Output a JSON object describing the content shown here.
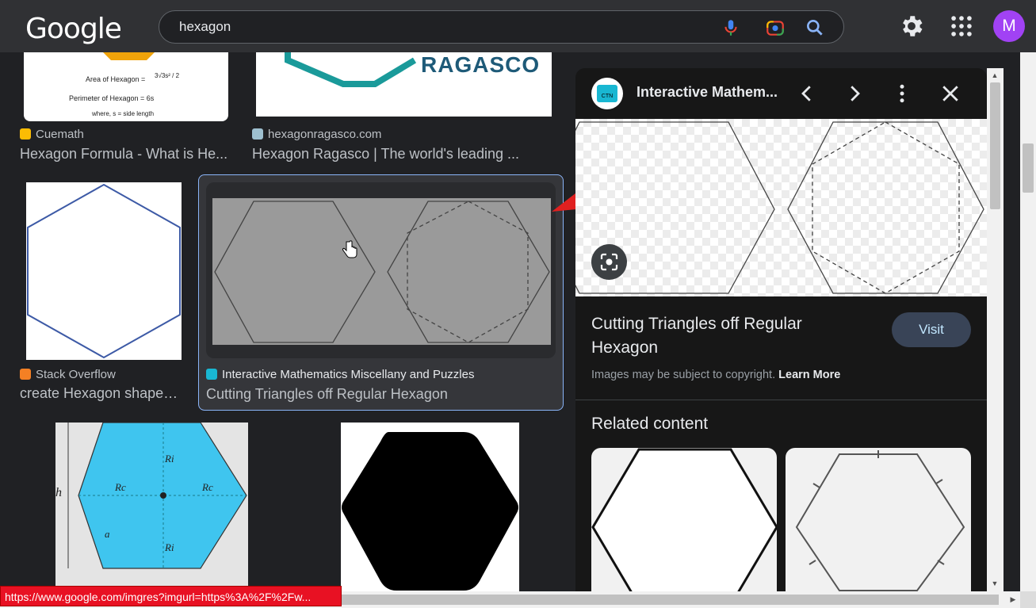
{
  "header": {
    "logo": "Google",
    "search_value": "hexagon",
    "avatar_letter": "M"
  },
  "results": [
    {
      "source": "Cuemath",
      "title": "Hexagon Formula - What is He...",
      "formula_area": "Area of Hexagon =",
      "formula_area_val": "3√3s² / 2",
      "formula_perim": "Perimeter of Hexagon = 6s",
      "formula_note": "where, s = side length"
    },
    {
      "source": "hexagonragasco.com",
      "title": "Hexagon Ragasco | The world's leading ...",
      "brand": "RAGASCO"
    },
    {
      "source": "Stack Overflow",
      "title": "create Hexagon shape ..."
    },
    {
      "source": "Interactive Mathematics Miscellany and Puzzles",
      "title": "Cutting Triangles off Regular Hexagon"
    },
    {
      "label_h": "h",
      "label_ri": "Ri",
      "label_rc": "Rc",
      "label_a": "a"
    },
    {}
  ],
  "panel": {
    "site_name": "Interactive Mathem...",
    "site_logo_text": "CTN",
    "title": "Cutting Triangles off Regular Hexagon",
    "visit_label": "Visit",
    "copyright_text": "Images may be subject to copyright.",
    "learn_more": "Learn More",
    "related_heading": "Related content"
  },
  "status_url": "https://www.google.com/imgres?imgurl=https%3A%2F%2Fw...",
  "colors": {
    "accent": "#8ab4f8",
    "arrow": "#e02020",
    "hex_blue": "#3fc5ef"
  }
}
